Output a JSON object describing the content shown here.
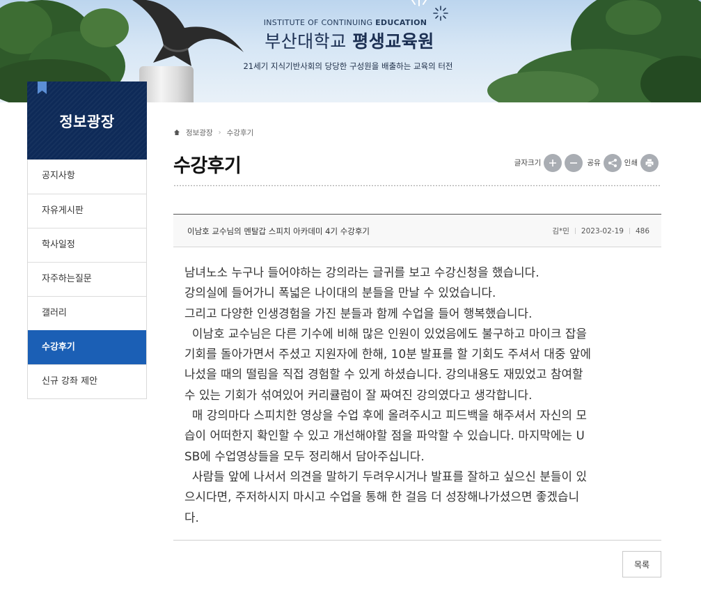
{
  "header": {
    "institute_en_prefix": "INSTITUTE OF CONTINUING ",
    "institute_en_bold": "EDUCATION",
    "institute_ko_prefix": "부산대학교 ",
    "institute_ko_bold": "평생교육원",
    "slogan": "21세기 지식기반사회의 당당한 구성원을 배출하는 교육의 터전"
  },
  "sidebar": {
    "title": "정보광장",
    "items": [
      {
        "label": "공지사항"
      },
      {
        "label": "자유게시판"
      },
      {
        "label": "학사일정"
      },
      {
        "label": "자주하는질문"
      },
      {
        "label": "갤러리"
      },
      {
        "label": "수강후기",
        "active": true
      },
      {
        "label": "신규 강좌 제안"
      }
    ]
  },
  "breadcrumb": [
    "정보광장",
    "수강후기"
  ],
  "page_title": "수강후기",
  "tools": {
    "font_size_label": "글자크기",
    "share_label": "공유",
    "print_label": "인쇄"
  },
  "post": {
    "title": "이남호 교수님의 멘탈갑 스피치 아카데미 4기 수강후기",
    "author": "김*민",
    "date": "2023-02-19",
    "views": "486",
    "lines": [
      "남녀노소 누구나 들어야하는 강의라는 글귀를 보고 수강신청을 했습니다.",
      "강의실에 들어가니 폭넓은 나이대의 분들을 만날 수 있었습니다.",
      "그리고 다양한 인생경험을 가진 분들과 함께 수업을 들어 행복했습니다.",
      "  이남호 교수님은 다른 기수에 비해 많은 인원이 있었음에도 불구하고 마이크 잡을",
      "기회를 돌아가면서 주셨고 지원자에 한해, 10분 발표를 할 기회도 주셔서 대중 앞에",
      "나섰을 때의 떨림을 직접 경험할 수 있게 하셨습니다. 강의내용도 재밌었고 참여할",
      "수 있는 기회가 섞여있어 커리큘럼이 잘 짜여진 강의였다고 생각합니다.",
      "  매 강의마다 스피치한 영상을 수업 후에 올려주시고 피드백을 해주셔서 자신의 모",
      "습이 어떠한지 확인할 수 있고 개선해야할 점을 파악할 수 있습니다. 마지막에는 U",
      "SB에 수업영상들을 모두 정리해서 담아주십니다.",
      "  사람들 앞에 나서서 의견을 말하기 두려우시거나 발표를 잘하고 싶으신 분들이 있",
      "으시다면, 주저하시지 마시고 수업을 통해 한 걸음 더 성장해나가셨으면 좋겠습니",
      "다."
    ]
  },
  "list_button": "목록",
  "colors": {
    "sidebar_head": "#0e2a58",
    "active_menu": "#1b5fb5",
    "tool_circle": "#a9adb3"
  }
}
